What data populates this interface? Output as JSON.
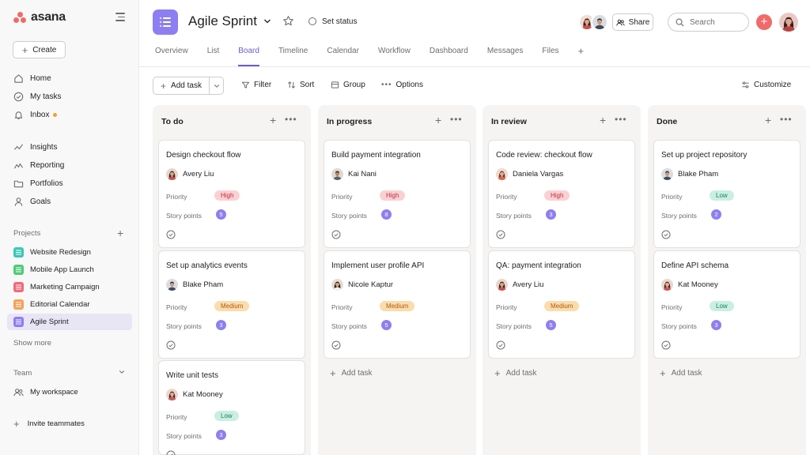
{
  "brand": {
    "name": "asana",
    "accent": "#f06a6a",
    "purple": "#8d7ff1"
  },
  "sidebar": {
    "create_label": "Create",
    "nav": [
      {
        "label": "Home",
        "icon": "home-icon"
      },
      {
        "label": "My tasks",
        "icon": "check-circle-icon"
      },
      {
        "label": "Inbox",
        "icon": "bell-icon",
        "badge": "unread-dot"
      }
    ],
    "nav2": [
      {
        "label": "Insights",
        "icon": "insights-icon"
      },
      {
        "label": "Reporting",
        "icon": "reporting-icon"
      },
      {
        "label": "Portfolios",
        "icon": "folder-icon"
      },
      {
        "label": "Goals",
        "icon": "goals-icon"
      }
    ],
    "projects_label": "Projects",
    "projects": [
      {
        "label": "Website Redesign",
        "color": "#3bc7b8"
      },
      {
        "label": "Mobile App Launch",
        "color": "#4ecb7a"
      },
      {
        "label": "Marketing Campaign",
        "color": "#f06a78"
      },
      {
        "label": "Editorial Calendar",
        "color": "#f4a259"
      },
      {
        "label": "Agile Sprint",
        "color": "#8d7ff1",
        "active": true
      }
    ],
    "show_more": "Show more",
    "team_label": "Team",
    "workspace": "My workspace",
    "invite": "Invite teammates"
  },
  "header": {
    "title": "Agile Sprint",
    "set_status": "Set status",
    "share": "Share",
    "search_placeholder": "Search"
  },
  "tabs": [
    {
      "label": "Overview"
    },
    {
      "label": "List"
    },
    {
      "label": "Board",
      "active": true
    },
    {
      "label": "Timeline"
    },
    {
      "label": "Calendar"
    },
    {
      "label": "Workflow"
    },
    {
      "label": "Dashboard"
    },
    {
      "label": "Messages"
    },
    {
      "label": "Files"
    }
  ],
  "toolbar": {
    "add_task": "Add task",
    "filter": "Filter",
    "sort": "Sort",
    "group": "Group",
    "options": "Options",
    "customize": "Customize"
  },
  "field_labels": {
    "priority": "Priority",
    "story_points": "Story points",
    "add_task": "Add task"
  },
  "columns": [
    {
      "title": "To do",
      "cards": [
        {
          "title": "Design checkout flow",
          "assignee": "Avery Liu",
          "priority": "High",
          "points": "5"
        },
        {
          "title": "Set up analytics events",
          "assignee": "Blake Pham",
          "priority": "Medium",
          "points": "3"
        },
        {
          "title": "Write unit tests",
          "assignee": "Kat Mooney",
          "priority": "Low",
          "points": "3"
        }
      ]
    },
    {
      "title": "In progress",
      "cards": [
        {
          "title": "Build payment integration",
          "assignee": "Kai Nani",
          "priority": "High",
          "points": "8"
        },
        {
          "title": "Implement user profile API",
          "assignee": "Nicole Kaptur",
          "priority": "Medium",
          "points": "5"
        }
      ]
    },
    {
      "title": "In review",
      "cards": [
        {
          "title": "Code review: checkout flow",
          "assignee": "Daniela Vargas",
          "priority": "High",
          "points": "3"
        },
        {
          "title": "QA: payment integration",
          "assignee": "Avery Liu",
          "priority": "Medium",
          "points": "5"
        }
      ]
    },
    {
      "title": "Done",
      "cards": [
        {
          "title": "Set up project repository",
          "assignee": "Blake Pham",
          "priority": "Low",
          "points": "2"
        },
        {
          "title": "Define API schema",
          "assignee": "Kat Mooney",
          "priority": "Low",
          "points": "3"
        }
      ]
    }
  ]
}
